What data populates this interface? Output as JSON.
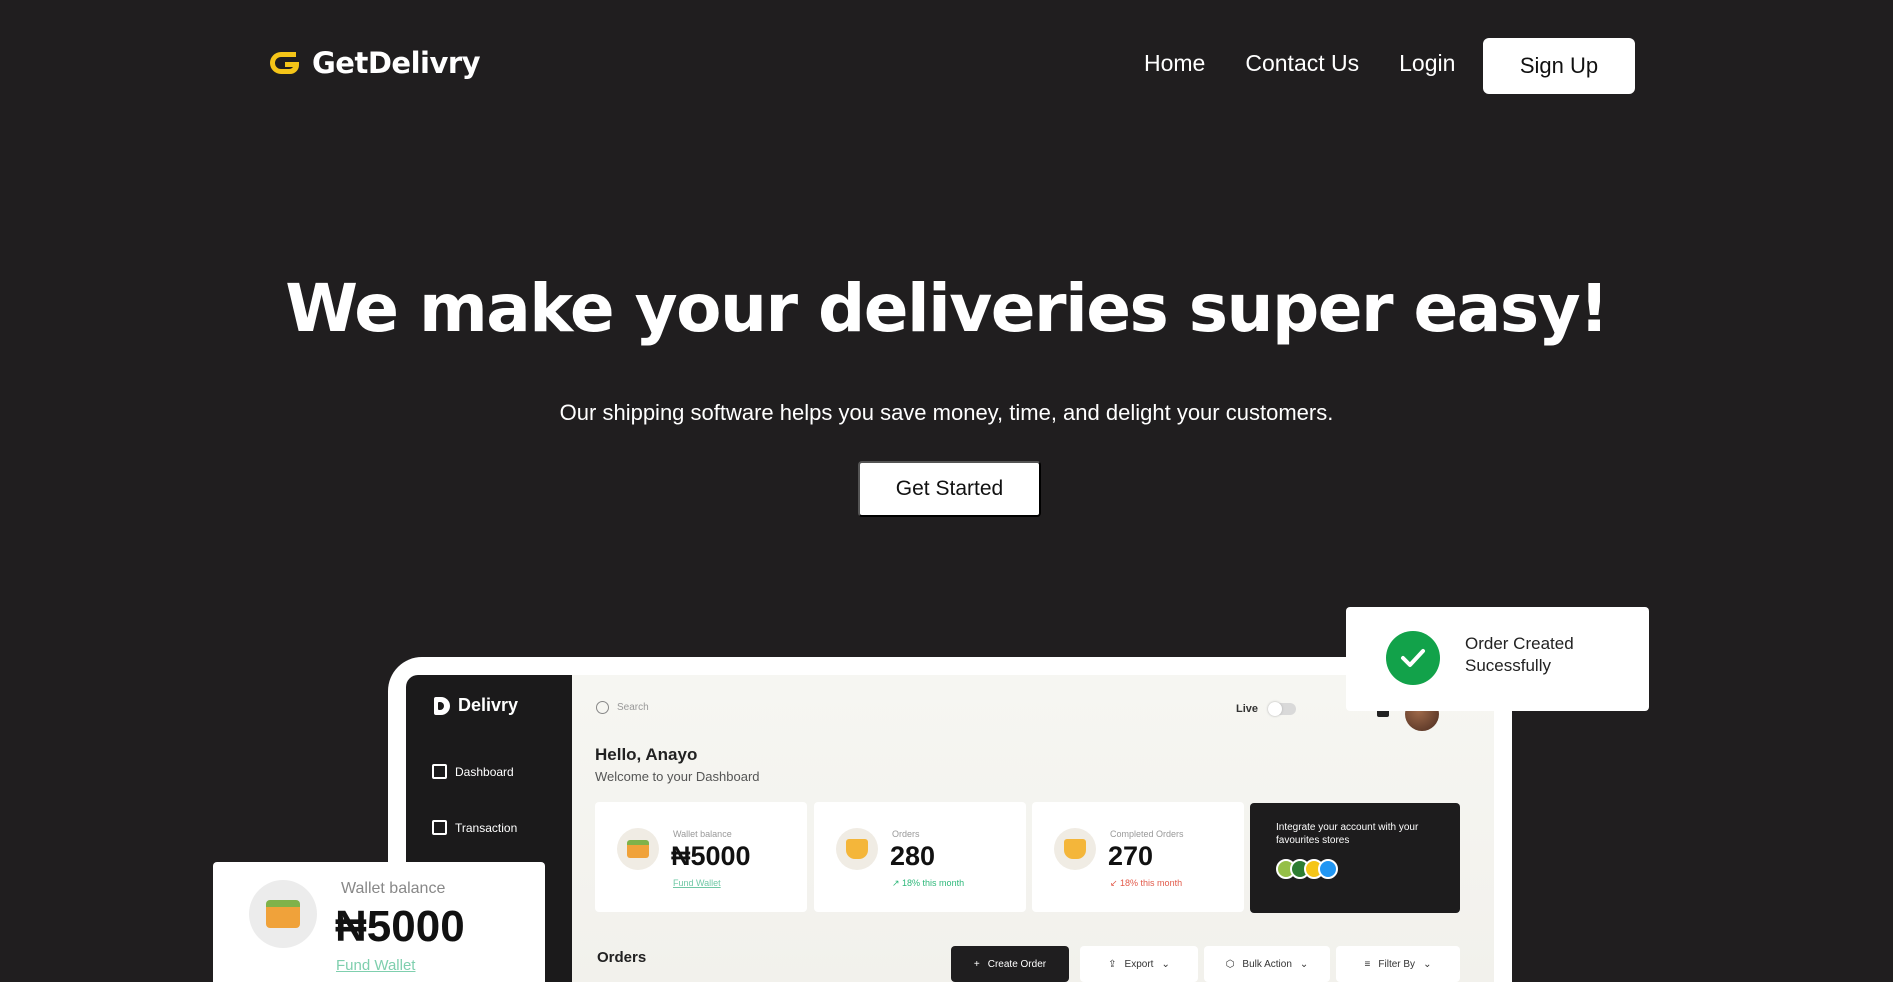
{
  "nav": {
    "brand": "GetDelivry",
    "links": [
      "Home",
      "Contact Us",
      "Login"
    ],
    "signup_label": "Sign Up"
  },
  "hero": {
    "title": "We make your deliveries super easy!",
    "subtitle": "Our shipping software helps you save money, time, and delight your customers.",
    "cta_label": "Get Started"
  },
  "dashboard": {
    "brand": "Delivry",
    "sidebar": [
      "Dashboard",
      "Transaction"
    ],
    "search_placeholder": "Search",
    "live_label": "Live",
    "greeting": "Hello, Anayo",
    "welcome": "Welcome to  your Dashboard",
    "stats": [
      {
        "label": "Wallet balance",
        "value": "₦5000",
        "sub": "Fund Wallet"
      },
      {
        "label": "Orders",
        "value": "280",
        "sub": "↗ 18% this month"
      },
      {
        "label": "Completed Orders",
        "value": "270",
        "sub": "↙ 18% this month"
      }
    ],
    "integrate_text": "Integrate your account with your favourites stores",
    "orders_label": "Orders",
    "toolbar": {
      "create": "Create Order",
      "export": "Export",
      "bulk": "Bulk Action",
      "filter": "Filter By"
    }
  },
  "wallet_card": {
    "label": "Wallet balance",
    "value": "₦5000",
    "link": "Fund Wallet"
  },
  "toast": {
    "message": "Order Created Sucessfully"
  },
  "colors": {
    "background": "#201e1f",
    "brand_yellow": "#f5c518",
    "success_green": "#12a24a",
    "link_green": "#7fcfae"
  }
}
